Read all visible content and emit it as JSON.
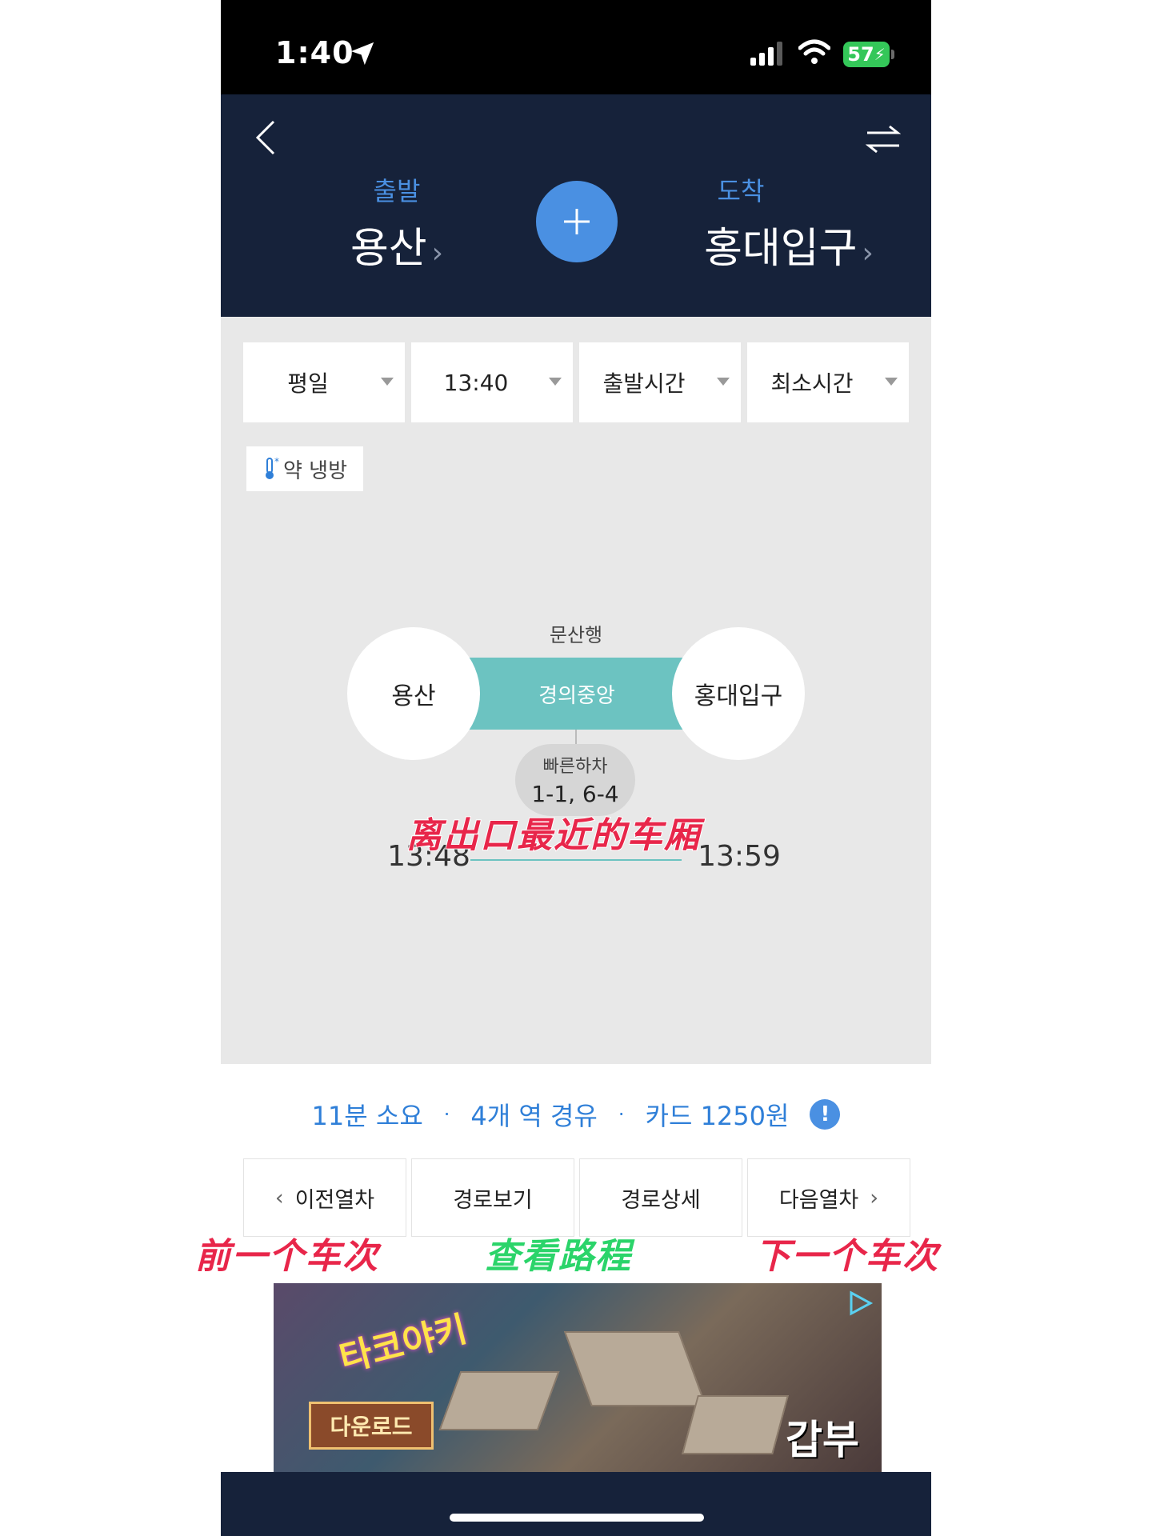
{
  "status_bar": {
    "time": "1:40",
    "battery": "57"
  },
  "header": {
    "departure_label": "출발",
    "departure_station": "용산",
    "arrival_label": "도착",
    "arrival_station": "홍대입구"
  },
  "filters": [
    {
      "label": "평일"
    },
    {
      "label": "13:40"
    },
    {
      "label": "출발시간"
    },
    {
      "label": "최소시간"
    }
  ],
  "ac_tag": "약 냉방",
  "route": {
    "direction": "문산행",
    "line_name": "경의중앙",
    "from": "용산",
    "to": "홍대입구",
    "fast_exit_title": "빠른하차",
    "fast_exit_value": "1-1, 6-4",
    "depart_time": "13:48",
    "arrive_time": "13:59"
  },
  "summary": {
    "duration": "11분 소요",
    "stations": "4개 역 경유",
    "fare": "카드 1250원"
  },
  "nav_buttons": {
    "prev": "이전열차",
    "view": "경로보기",
    "detail": "경로상세",
    "next": "다음열차"
  },
  "ad": {
    "sign_text": "타코야키",
    "download": "다운로드",
    "logo": "갑부"
  },
  "annotations": {
    "nearest_car": "离出口最近的车厢",
    "prev_train": "前一个车次",
    "view_route": "查看路程",
    "next_train": "下一个车次"
  },
  "colors": {
    "header_bg": "#16223a",
    "accent_blue": "#4a90e2",
    "line_teal": "#6cc3c1",
    "annotation_red": "#e8264a",
    "annotation_green": "#2bd46a"
  }
}
